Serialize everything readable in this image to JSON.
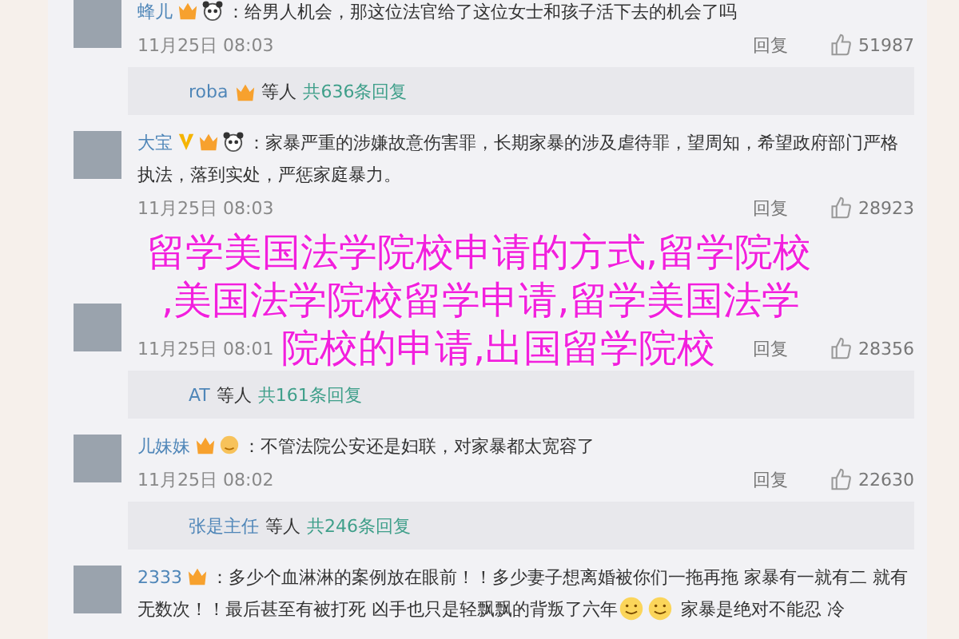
{
  "feed": [
    {
      "kind": "comment",
      "name": "蜂儿",
      "badges": [
        {
          "kind": "vip"
        },
        {
          "kind": "panda"
        }
      ],
      "segments": [
        {
          "kind": "text",
          "text": "：给男人机会，那这位法官给了这位女士和孩子活下去的机会了吗"
        }
      ],
      "time": "11月25日 08:03",
      "reply": "回复",
      "likes": "51987"
    },
    {
      "kind": "replies",
      "name": "roba",
      "badges": [
        {
          "kind": "vip"
        }
      ],
      "others": "等人",
      "count": "共636条回复"
    },
    {
      "kind": "comment",
      "name": "大宝",
      "badges": [
        {
          "kind": "verified"
        },
        {
          "kind": "vip"
        },
        {
          "kind": "panda"
        }
      ],
      "segments": [
        {
          "kind": "text",
          "text": "：家暴严重的涉嫌故意伤害罪，长期家暴的涉及虐待罪，望周知，希望政府部门严格执法，落到实处，严惩家庭暴力。"
        }
      ],
      "time": "11月25日 08:03",
      "reply": "回复",
      "likes": "28923"
    },
    {
      "kind": "comment",
      "time": "11月25日 08:01",
      "reply": "回复",
      "likes": "28356"
    },
    {
      "kind": "replies",
      "name": "AT",
      "others": "等人",
      "count": "共161条回复"
    },
    {
      "kind": "comment",
      "name": "儿妹妹",
      "badges": [
        {
          "kind": "vip"
        },
        {
          "kind": "face"
        }
      ],
      "segments": [
        {
          "kind": "text",
          "text": "：不管法院公安还是妇联，对家暴都太宽容了"
        }
      ],
      "time": "11月25日 08:02",
      "reply": "回复",
      "likes": "22630"
    },
    {
      "kind": "replies",
      "name": "张是主任",
      "others": "等人",
      "count": "共246条回复"
    },
    {
      "kind": "comment",
      "name": "2333",
      "badges": [
        {
          "kind": "vip"
        }
      ],
      "segments": [
        {
          "kind": "text",
          "text": "：多少个血淋淋的案例放在眼前！！多少妻子想离婚被你们一拖再拖 家暴有一就有二 就有无数次！！最后甚至有被打死 凶手也只是轻飘飘的背叛了六年"
        },
        {
          "kind": "emoji"
        },
        {
          "kind": "emoji"
        },
        {
          "kind": "text",
          "text": " 家暴是绝对不能忍 冷"
        }
      ]
    }
  ],
  "overlay_title_lines": [
    "留学美国法学院校申请的方式,留学院校",
    ",美国法学院校留学申请,留学美国法学",
    "院校的申请,出国留学院校"
  ]
}
